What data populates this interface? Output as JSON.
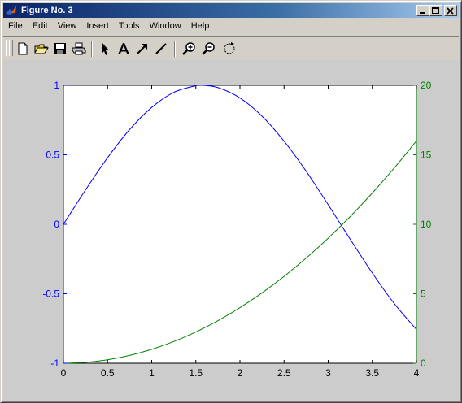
{
  "window": {
    "title": "Figure No. 3"
  },
  "menu": {
    "items": [
      "File",
      "Edit",
      "View",
      "Insert",
      "Tools",
      "Window",
      "Help"
    ]
  },
  "toolbar": {
    "buttons": [
      {
        "icon": "new-document-icon"
      },
      {
        "icon": "open-folder-icon"
      },
      {
        "icon": "save-icon"
      },
      {
        "icon": "print-icon"
      },
      {
        "icon": "select-arrow-icon"
      },
      {
        "icon": "insert-text-icon"
      },
      {
        "icon": "insert-arrow-icon"
      },
      {
        "icon": "insert-line-icon"
      },
      {
        "icon": "zoom-in-icon"
      },
      {
        "icon": "zoom-out-icon"
      },
      {
        "icon": "rotate-3d-icon"
      }
    ]
  },
  "colors": {
    "left_axis": "#0000ff",
    "right_axis": "#008000",
    "figure_bg": "#cccccc",
    "axes_bg": "#ffffff"
  },
  "chart_data": {
    "type": "line",
    "title": "",
    "xlabel": "",
    "ylabel": "",
    "ylabel_right": "",
    "xlim": [
      0,
      4
    ],
    "ylim_left": [
      -1,
      1
    ],
    "ylim_right": [
      0,
      20
    ],
    "grid": false,
    "x_ticks": [
      "0",
      "0.5",
      "1",
      "1.5",
      "2",
      "2.5",
      "3",
      "3.5",
      "4"
    ],
    "y_left_ticks": [
      "-1",
      "-0.5",
      "0",
      "0.5",
      "1"
    ],
    "y_right_ticks": [
      "0",
      "5",
      "10",
      "15",
      "20"
    ],
    "series": [
      {
        "axis": "left",
        "color": "#0000ff",
        "x": [
          0,
          0.25,
          0.5,
          0.75,
          1.0,
          1.25,
          1.5,
          1.5708,
          1.75,
          2.0,
          2.25,
          2.5,
          2.75,
          3.0,
          3.1416,
          3.25,
          3.5,
          3.75,
          4.0
        ],
        "y": [
          0,
          0.247,
          0.479,
          0.682,
          0.841,
          0.949,
          0.997,
          1.0,
          0.984,
          0.909,
          0.778,
          0.598,
          0.382,
          0.141,
          0.0,
          -0.108,
          -0.351,
          -0.572,
          -0.757
        ]
      },
      {
        "axis": "right",
        "color": "#008000",
        "x": [
          0,
          0.25,
          0.5,
          0.75,
          1.0,
          1.25,
          1.5,
          1.75,
          2.0,
          2.25,
          2.5,
          2.75,
          3.0,
          3.25,
          3.5,
          3.75,
          4.0
        ],
        "y": [
          0,
          0.0625,
          0.25,
          0.5625,
          1.0,
          1.5625,
          2.25,
          3.0625,
          4.0,
          5.0625,
          6.25,
          7.5625,
          9.0,
          10.5625,
          12.25,
          14.0625,
          16.0
        ]
      }
    ]
  }
}
